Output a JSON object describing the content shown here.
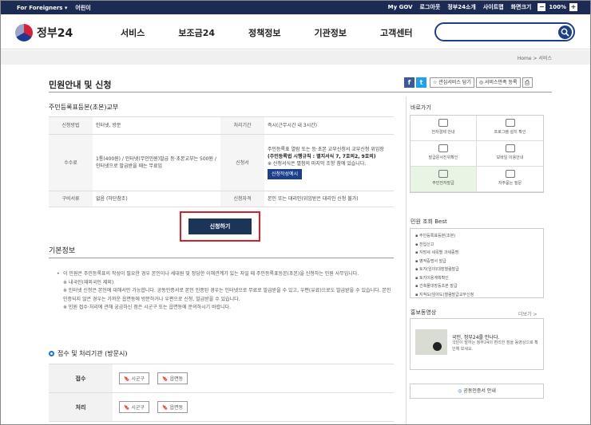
{
  "topbar": {
    "foreigners": "For Foreigners ▾",
    "kids": "어린이",
    "links": [
      "My GOV",
      "로그아웃",
      "정부24소개",
      "사이트맵",
      "화면크기"
    ],
    "zoom_minus": "−",
    "zoom_value": "100%",
    "zoom_plus": "+"
  },
  "header": {
    "logo": "정부24",
    "nav": [
      "서비스",
      "보조금24",
      "정책정보",
      "기관정보",
      "고객센터"
    ],
    "search_placeholder": ""
  },
  "breadcrumb": "Home  >  서비스",
  "page": {
    "title": "민원안내 및 신청",
    "sns": {
      "facebook": "f",
      "twitter": "t"
    },
    "interest_btn": "☆ 관심서비스 담기",
    "satisfaction_btn": "◎ 서비스만족 등록",
    "print": "⎙"
  },
  "service": {
    "name": "주민등록표등본(초본)교부",
    "rows": [
      {
        "h1": "신청방법",
        "v1": "인터넷, 방문",
        "h2": "처리기간",
        "v2": "즉시(근무시간 내 3시간)"
      },
      {
        "h1": "수수료",
        "v1": "1통(400원) / 인터넷(무인민원)발급 등·초본교부는 500원 / 인터넷으로 발급받을 때는 무료임",
        "h2": "신청서",
        "v2": "주민등록표 열람 또는 등·초본 교부신청서 교부신청 위임장",
        "v2_bold": "(주민등록법 시행규칙 : 별지서식 7, 7호의2, 9호의)",
        "v2_note": "※ 신청서식은 별첨의 마지막 조항 참에 있습니다.",
        "form_btn": "신청작성예시"
      },
      {
        "h1": "구비서류",
        "v1": "없음 (하단참조)",
        "h2": "신청자격",
        "v2": "본인 또는 대리인(위임받은 대리인 신청 불가)"
      }
    ],
    "apply": "신청하기"
  },
  "basic": {
    "title": "기본정보",
    "lines": [
      "이 민원은 주민등록표의 작성이 필요한 경우 본인이나 세대원 및 정당한 이해관계가 있는 자일 때 주민등록표등본(초본)을 신청하는 민원 사무입니다.",
      "※ 내국인(재외국인 제외)",
      "※ 인터넷 신청은 본인에 대해서만 가능합니다. 공동인증서로 본인 인증된 경우는 인터넷으로 무료로 발급받을 수 있고, 우편(유료)으로도 발급받을 수 있습니다. 본인 인증되지 않은 경우는 가까운 읍면동에 방문하거나 우편으로 신청, 발급받을 수 있습니다.",
      "※ 민원 접수·처리에 관해 궁금하신 점은 시군구 또는 읍면동에 문의하시기 바랍니다."
    ]
  },
  "reception": {
    "title": "접수 및 처리기관 (방문시)",
    "rows": [
      {
        "label": "접수",
        "tags": [
          "시군구",
          "읍면동"
        ]
      },
      {
        "label": "처리",
        "tags": [
          "시군구",
          "읍면동"
        ]
      }
    ]
  },
  "sidebar": {
    "quick_title": "바로가기",
    "quick": [
      "전자결제 안내",
      "프로그램 설치 확인",
      "발급문서진위확인",
      "모바일 이용안내",
      "주민전자발급",
      "자주묻는 질문"
    ],
    "best_title": "민원 조회 Best",
    "best": [
      "주민등록표등본(초본)",
      "전입신고",
      "지방세 세목별 과세증명",
      "병적증명서 발급",
      "토지(임야)대장열람발급",
      "토지이용계획확인",
      "건축물대장등초본 발급",
      "지적도(임야도)열람발급교부신청",
      "가족관계증명(조선발급)열람신청"
    ],
    "video_title": "홍보동영상",
    "video_more": "더보기 >",
    "video_head": "국민, 정부24를 만나다.",
    "video_text": "국민이 말하는 정부24의 편리한 점을 동영상으로 확인해 보세요.",
    "cert": "공동인증서 안내"
  }
}
